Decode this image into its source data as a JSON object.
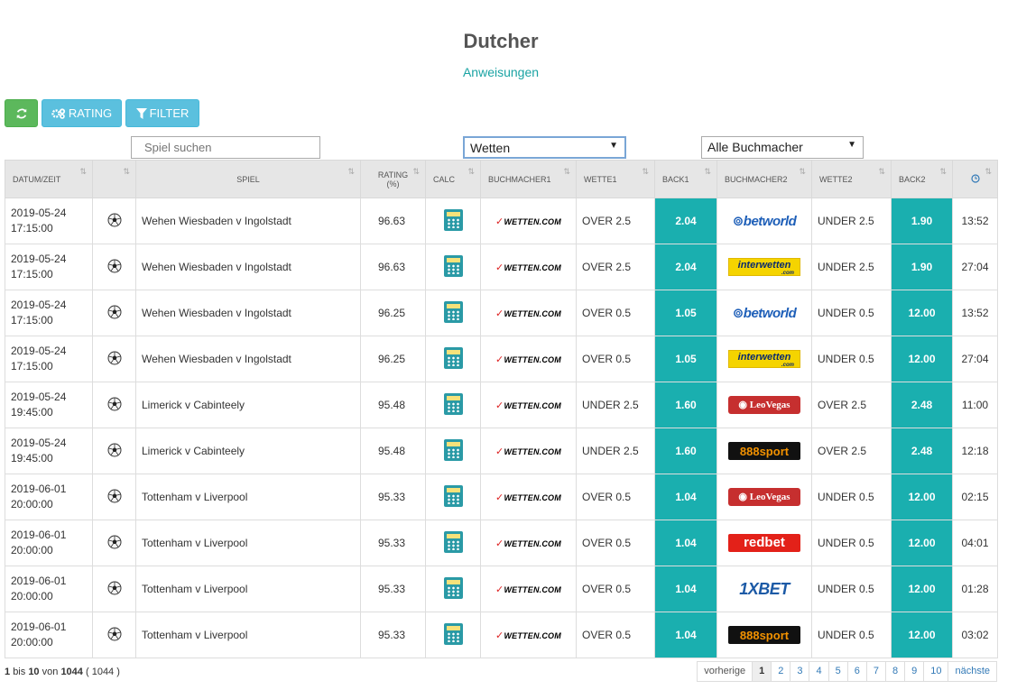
{
  "page": {
    "title": "Dutcher",
    "subtitle_link": "Anweisungen"
  },
  "toolbar": {
    "rating_label": "RATING",
    "filter_label": "FILTER"
  },
  "filters": {
    "search_placeholder": "Spiel suchen",
    "bet_select": "Wetten",
    "bookmaker_select": "Alle Buchmacher"
  },
  "table": {
    "headers": {
      "datum": "DATUM/ZEIT",
      "spiel": "SPIEL",
      "rating": "RATING",
      "rating_unit": "(%)",
      "calc": "CALC",
      "buch1": "BUCHMACHER1",
      "wette1": "WETTE1",
      "back1": "BACK1",
      "buch2": "BUCHMACHER2",
      "wette2": "WETTE2",
      "back2": "BACK2"
    },
    "rows": [
      {
        "date": "2019-05-24",
        "time": "17:15:00",
        "game": "Wehen Wiesbaden v Ingolstadt",
        "rating": "96.63",
        "bookmaker1": "WETTEN.COM",
        "bet1": "OVER 2.5",
        "back1": "2.04",
        "bookmaker2": "betworld",
        "bet2": "UNDER 2.5",
        "back2": "1.90",
        "age": "13:52"
      },
      {
        "date": "2019-05-24",
        "time": "17:15:00",
        "game": "Wehen Wiesbaden v Ingolstadt",
        "rating": "96.63",
        "bookmaker1": "WETTEN.COM",
        "bet1": "OVER 2.5",
        "back1": "2.04",
        "bookmaker2": "interwetten",
        "bet2": "UNDER 2.5",
        "back2": "1.90",
        "age": "27:04"
      },
      {
        "date": "2019-05-24",
        "time": "17:15:00",
        "game": "Wehen Wiesbaden v Ingolstadt",
        "rating": "96.25",
        "bookmaker1": "WETTEN.COM",
        "bet1": "OVER 0.5",
        "back1": "1.05",
        "bookmaker2": "betworld",
        "bet2": "UNDER 0.5",
        "back2": "12.00",
        "age": "13:52"
      },
      {
        "date": "2019-05-24",
        "time": "17:15:00",
        "game": "Wehen Wiesbaden v Ingolstadt",
        "rating": "96.25",
        "bookmaker1": "WETTEN.COM",
        "bet1": "OVER 0.5",
        "back1": "1.05",
        "bookmaker2": "interwetten",
        "bet2": "UNDER 0.5",
        "back2": "12.00",
        "age": "27:04"
      },
      {
        "date": "2019-05-24",
        "time": "19:45:00",
        "game": "Limerick v Cabinteely",
        "rating": "95.48",
        "bookmaker1": "WETTEN.COM",
        "bet1": "UNDER 2.5",
        "back1": "1.60",
        "bookmaker2": "LeoVegas",
        "bet2": "OVER 2.5",
        "back2": "2.48",
        "age": "11:00"
      },
      {
        "date": "2019-05-24",
        "time": "19:45:00",
        "game": "Limerick v Cabinteely",
        "rating": "95.48",
        "bookmaker1": "WETTEN.COM",
        "bet1": "UNDER 2.5",
        "back1": "1.60",
        "bookmaker2": "888sport",
        "bet2": "OVER 2.5",
        "back2": "2.48",
        "age": "12:18"
      },
      {
        "date": "2019-06-01",
        "time": "20:00:00",
        "game": "Tottenham v Liverpool",
        "rating": "95.33",
        "bookmaker1": "WETTEN.COM",
        "bet1": "OVER 0.5",
        "back1": "1.04",
        "bookmaker2": "LeoVegas",
        "bet2": "UNDER 0.5",
        "back2": "12.00",
        "age": "02:15"
      },
      {
        "date": "2019-06-01",
        "time": "20:00:00",
        "game": "Tottenham v Liverpool",
        "rating": "95.33",
        "bookmaker1": "WETTEN.COM",
        "bet1": "OVER 0.5",
        "back1": "1.04",
        "bookmaker2": "redbet",
        "bet2": "UNDER 0.5",
        "back2": "12.00",
        "age": "04:01"
      },
      {
        "date": "2019-06-01",
        "time": "20:00:00",
        "game": "Tottenham v Liverpool",
        "rating": "95.33",
        "bookmaker1": "WETTEN.COM",
        "bet1": "OVER 0.5",
        "back1": "1.04",
        "bookmaker2": "1XBET",
        "bet2": "UNDER 0.5",
        "back2": "12.00",
        "age": "01:28"
      },
      {
        "date": "2019-06-01",
        "time": "20:00:00",
        "game": "Tottenham v Liverpool",
        "rating": "95.33",
        "bookmaker1": "WETTEN.COM",
        "bet1": "OVER 0.5",
        "back1": "1.04",
        "bookmaker2": "888sport",
        "bet2": "UNDER 0.5",
        "back2": "12.00",
        "age": "03:02"
      }
    ]
  },
  "footer": {
    "from": "1",
    "bis": "bis",
    "to": "10",
    "von": "von",
    "total": "1044",
    "total_paren": "( 1044 )",
    "prev": "vorherige",
    "next": "nächste",
    "pages": [
      "1",
      "2",
      "3",
      "4",
      "5",
      "6",
      "7",
      "8",
      "9",
      "10"
    ],
    "active_page": "1"
  },
  "colors": {
    "accent": "#1aafaf",
    "refresh": "#5cb85c",
    "info": "#5bc0de"
  }
}
